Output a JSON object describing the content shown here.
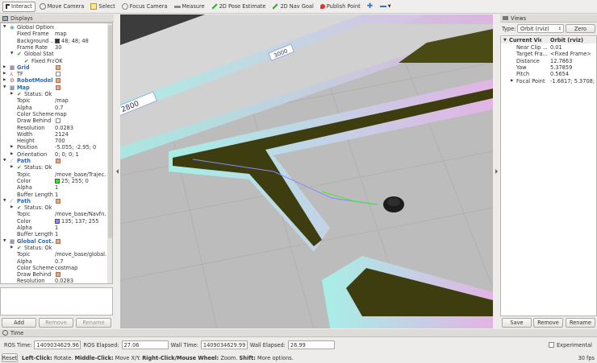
{
  "toolbar": {
    "tools": [
      "Interact",
      "Move Camera",
      "Select",
      "Focus Camera",
      "Measure",
      "2D Pose Estimate",
      "2D Nav Goal",
      "Publish Point"
    ]
  },
  "displays": {
    "title": "Displays",
    "rows": [
      {
        "k": "Global Options",
        "v": ""
      },
      {
        "k": "Fixed Frame",
        "v": "map"
      },
      {
        "k": "Background ...",
        "v": "48; 48; 48"
      },
      {
        "k": "Frame Rate",
        "v": "30"
      },
      {
        "k": "Global Status...",
        "v": ""
      },
      {
        "k": "Fixed Frame",
        "v": "OK"
      },
      {
        "k": "Grid",
        "v": ""
      },
      {
        "k": "TF",
        "v": ""
      },
      {
        "k": "RobotModel",
        "v": ""
      },
      {
        "k": "Map",
        "v": ""
      },
      {
        "k": "Status: Ok",
        "v": ""
      },
      {
        "k": "Topic",
        "v": "/map"
      },
      {
        "k": "Alpha",
        "v": "0.7"
      },
      {
        "k": "Color Scheme",
        "v": "map"
      },
      {
        "k": "Draw Behind",
        "v": ""
      },
      {
        "k": "Resolution",
        "v": "0.0283"
      },
      {
        "k": "Width",
        "v": "2124"
      },
      {
        "k": "Height",
        "v": "700"
      },
      {
        "k": "Position",
        "v": "-5.055; -2.95; 0"
      },
      {
        "k": "Orientation",
        "v": "0; 0; 0; 1"
      },
      {
        "k": "Path",
        "v": ""
      },
      {
        "k": "Status: Ok",
        "v": ""
      },
      {
        "k": "Topic",
        "v": "/move_base/Trajec..."
      },
      {
        "k": "Color",
        "v": "25; 255; 0"
      },
      {
        "k": "Alpha",
        "v": "1"
      },
      {
        "k": "Buffer Length",
        "v": "1"
      },
      {
        "k": "Path",
        "v": ""
      },
      {
        "k": "Status: Ok",
        "v": ""
      },
      {
        "k": "Topic",
        "v": "/move_base/Navfn..."
      },
      {
        "k": "Color",
        "v": "135; 137; 255"
      },
      {
        "k": "Alpha",
        "v": "1"
      },
      {
        "k": "Buffer Length",
        "v": "1"
      },
      {
        "k": "Global Cost...",
        "v": ""
      },
      {
        "k": "Status: Ok",
        "v": ""
      },
      {
        "k": "Topic",
        "v": "/move_base/global..."
      },
      {
        "k": "Alpha",
        "v": "0.7"
      },
      {
        "k": "Color Scheme",
        "v": "costmap"
      },
      {
        "k": "Draw Behind",
        "v": ""
      },
      {
        "k": "Resolution",
        "v": "0.0283"
      }
    ],
    "add": "Add",
    "remove": "Remove",
    "rename": "Rename"
  },
  "map_labels": [
    "2800",
    "3000"
  ],
  "views": {
    "title": "Views",
    "type_label": "Type:",
    "type_value": "Orbit (rviz)",
    "zero": "Zero",
    "header_k": "Current View",
    "header_v": "Orbit (rviz)",
    "rows": [
      {
        "k": "Near Clip ...",
        "v": "0.01"
      },
      {
        "k": "Target Fra...",
        "v": "<Fixed Frame>"
      },
      {
        "k": "Distance",
        "v": "12.7863"
      },
      {
        "k": "Yaw",
        "v": "5.37859"
      },
      {
        "k": "Pitch",
        "v": "0.5654"
      },
      {
        "k": "Focal Point",
        "v": "-1.6817; 5.3708; -..."
      }
    ],
    "save": "Save",
    "remove": "Remove",
    "rename": "Rename"
  },
  "time": {
    "title": "Time",
    "ros_time_label": "ROS Time:",
    "ros_time": "1409034629.96",
    "ros_elapsed_label": "ROS Elapsed:",
    "ros_elapsed": "27.06",
    "wall_time_label": "Wall Time:",
    "wall_time": "1409034629.99",
    "wall_elapsed_label": "Wall Elapsed:",
    "wall_elapsed": "26.99",
    "experimental": "Experimental"
  },
  "status": {
    "reset": "Reset",
    "b1": "Left-Click:",
    "t1": "Rotate.",
    "b2": "Middle-Click:",
    "t2": "Move X/Y.",
    "b3": "Right-Click/Mouse Wheel:",
    "t3": "Zoom.",
    "b4": "Shift:",
    "t4": "More options.",
    "fps": "30 fps"
  }
}
